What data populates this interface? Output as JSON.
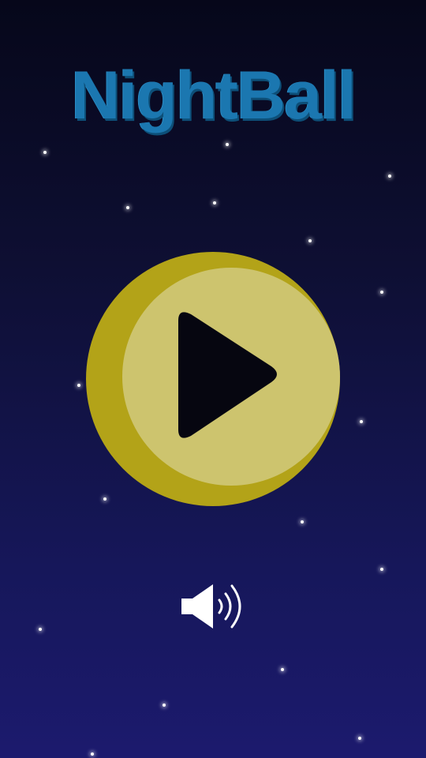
{
  "game": {
    "title": "NightBall"
  },
  "controls": {
    "play": {
      "icon": "play-icon"
    },
    "sound": {
      "icon": "speaker-volume-icon",
      "state": "on"
    }
  },
  "colors": {
    "title": "#1b77b0",
    "moon_face": "#cdc46e",
    "moon_rim": "#b3a318",
    "play_triangle": "#060610",
    "star": "#ffffff",
    "sound_icon": "#ffffff"
  }
}
